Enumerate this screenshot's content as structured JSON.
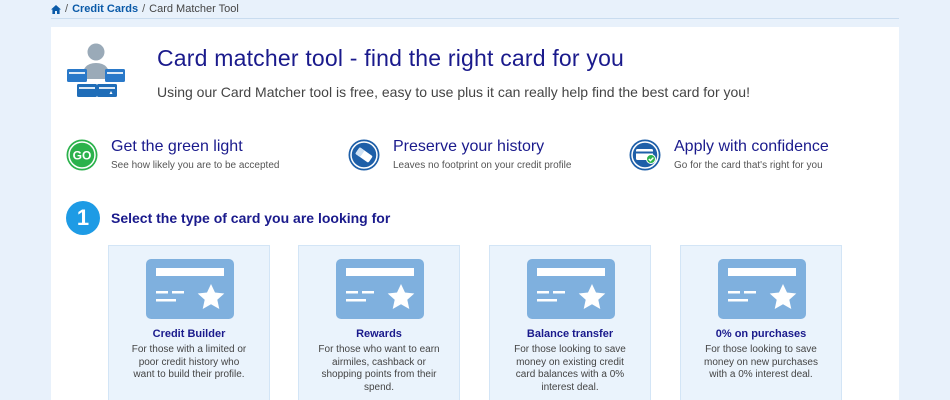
{
  "breadcrumb": {
    "home_icon": "home-icon",
    "items": [
      "Credit Cards",
      "Card Matcher Tool"
    ],
    "separator": "/"
  },
  "hero": {
    "icon": "person-with-cards-icon",
    "title": "Card matcher tool - find the right card for you",
    "subtitle": "Using our Card Matcher tool is free, easy to use plus it can really help find the best card for you!"
  },
  "benefits": [
    {
      "icon": "go-icon",
      "icon_text": "GO",
      "title": "Get the green light",
      "desc": "See how likely you are to be accepted"
    },
    {
      "icon": "eraser-icon",
      "title": "Preserve your history",
      "desc": "Leaves no footprint on your credit profile"
    },
    {
      "icon": "card-check-icon",
      "title": "Apply with confidence",
      "desc": "Go for the card that's right for you"
    }
  ],
  "step": {
    "number": "1",
    "title": "Select the type of card you are looking for"
  },
  "cards": [
    {
      "icon": "credit-card-star-icon",
      "name": "Credit Builder",
      "desc": "For those with a limited or poor credit history who want to build their profile."
    },
    {
      "icon": "credit-card-star-icon",
      "name": "Rewards",
      "desc": "For those who want to earn airmiles, cashback or shopping points from their spend."
    },
    {
      "icon": "credit-card-star-icon",
      "name": "Balance transfer",
      "desc": "For those looking to save money on existing credit card balances with a 0% interest deal."
    },
    {
      "icon": "credit-card-star-icon",
      "name": "0% on purchases",
      "desc": "For those looking to save money on new purchases with a 0% interest deal."
    }
  ],
  "colors": {
    "title_blue": "#1a1a8c",
    "link_blue": "#0a5aa8",
    "accent_blue": "#1e9be5",
    "card_icon_blue": "#7fb0de",
    "go_green": "#2bb24c",
    "page_bg": "#e8f1fb"
  }
}
